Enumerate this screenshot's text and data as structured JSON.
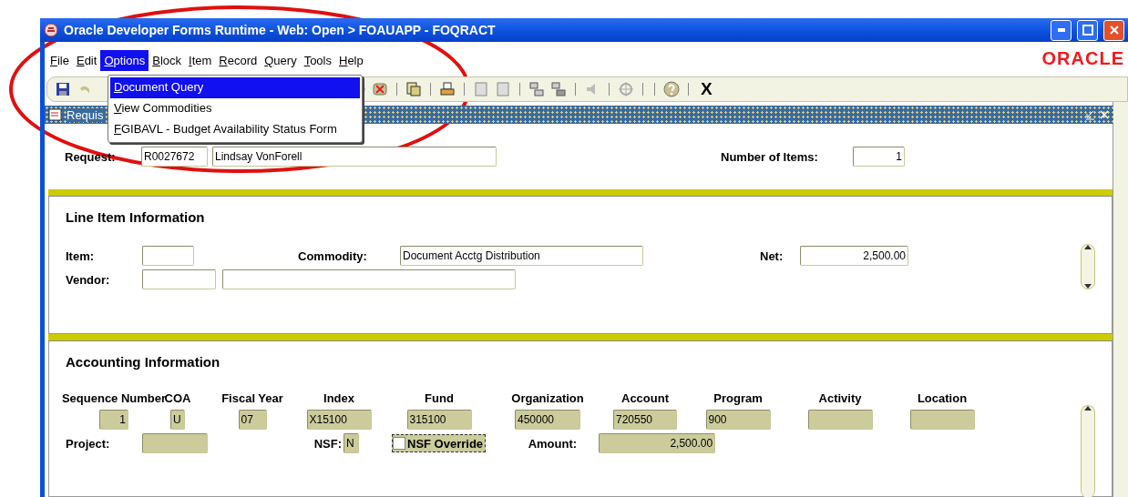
{
  "window": {
    "title": "Oracle Developer Forms Runtime - Web:  Open > FOAUAPP - FOQRACT"
  },
  "menu_bar": [
    {
      "label": "File",
      "selected": false
    },
    {
      "label": "Edit",
      "selected": false
    },
    {
      "label": "Options",
      "selected": true
    },
    {
      "label": "Block",
      "selected": false
    },
    {
      "label": "Item",
      "selected": false
    },
    {
      "label": "Record",
      "selected": false
    },
    {
      "label": "Query",
      "selected": false
    },
    {
      "label": "Tools",
      "selected": false
    },
    {
      "label": "Help",
      "selected": false
    }
  ],
  "logo": "ORACLE",
  "open_menu": {
    "items": [
      {
        "label": "Document Query",
        "selected": true
      },
      {
        "label": "View Commodities",
        "selected": false
      },
      {
        "label": "FGIBAVL - Budget Availability Status Form",
        "selected": false
      }
    ]
  },
  "toolbar": {
    "exit_label": "X"
  },
  "form_window": {
    "title": "Requis"
  },
  "header": {
    "request_label": "Request:",
    "request_id": "R0027672",
    "requester": "Lindsay VonForell",
    "items_label": "Number of Items:",
    "items_count": "1"
  },
  "line_item": {
    "title": "Line Item Information",
    "item_label": "Item:",
    "commodity_label": "Commodity:",
    "commodity": "Document Acctg Distribution",
    "net_label": "Net:",
    "net": "2,500.00",
    "vendor_label": "Vendor:"
  },
  "accounting": {
    "title": "Accounting Information",
    "columns": [
      {
        "label": "Sequence Number",
        "value": "1"
      },
      {
        "label": "COA",
        "value": "U"
      },
      {
        "label": "Fiscal Year",
        "value": "07"
      },
      {
        "label": "Index",
        "value": "X15100"
      },
      {
        "label": "Fund",
        "value": "315100"
      },
      {
        "label": "Organization",
        "value": "450000"
      },
      {
        "label": "Account",
        "value": "720550"
      },
      {
        "label": "Program",
        "value": "900"
      },
      {
        "label": "Activity"
      },
      {
        "label": "Location"
      }
    ],
    "project_label": "Project:",
    "nsf_label": "NSF:",
    "nsf": "N",
    "nsf_override": {
      "label": "NSF Override",
      "checked": false
    },
    "amount_label": "Amount:",
    "amount": "2,500.00"
  }
}
